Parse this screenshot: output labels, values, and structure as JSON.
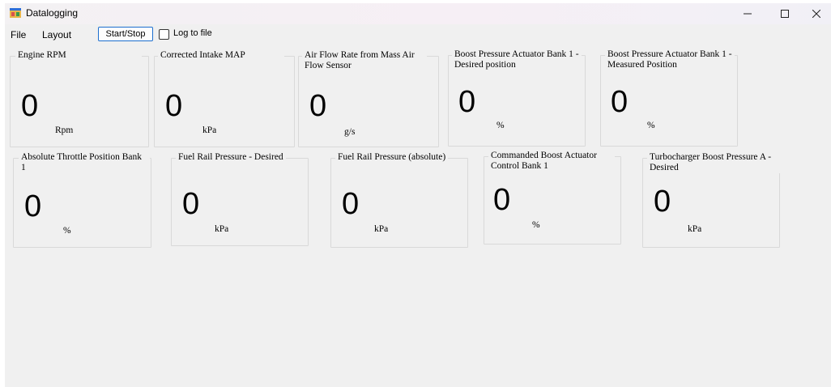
{
  "window": {
    "title": "Datalogging",
    "icon": "app-window-icon",
    "controls": {
      "minimize": "minimize-icon",
      "maximize": "maximize-icon",
      "close": "close-icon"
    }
  },
  "menu": {
    "file": "File",
    "layout": "Layout",
    "start_stop": "Start/Stop",
    "log_to_file": "Log to file",
    "log_to_file_checked": false
  },
  "gauges": [
    {
      "title": "Engine RPM",
      "value": "0",
      "unit": "Rpm"
    },
    {
      "title": "Corrected Intake MAP",
      "value": "0",
      "unit": "kPa"
    },
    {
      "title": "Air Flow Rate from Mass Air Flow Sensor",
      "value": "0",
      "unit": "g/s"
    },
    {
      "title": "Boost Pressure Actuator Bank 1 - Desired position",
      "value": "0",
      "unit": "%"
    },
    {
      "title": "Boost Pressure Actuator Bank 1 - Measured Position",
      "value": "0",
      "unit": "%"
    },
    {
      "title": "Absolute Throttle Position Bank 1",
      "value": "0",
      "unit": "%"
    },
    {
      "title": "Fuel Rail Pressure - Desired",
      "value": "0",
      "unit": "kPa"
    },
    {
      "title": "Fuel Rail Pressure (absolute)",
      "value": "0",
      "unit": "kPa"
    },
    {
      "title": "Commanded Boost Actuator Control Bank 1",
      "value": "0",
      "unit": "%"
    },
    {
      "title": "Turbocharger Boost Pressure A - Desired",
      "value": "0",
      "unit": "kPa"
    }
  ]
}
